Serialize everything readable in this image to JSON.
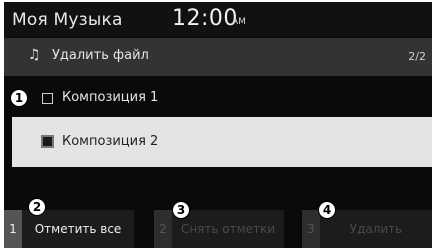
{
  "header": {
    "app_title": "Моя Музыка",
    "time": "12:00",
    "ampm": "AM"
  },
  "subheader": {
    "icon": "music-note-icon",
    "title": "Удалить файл",
    "page_indicator": "2/2"
  },
  "list": {
    "items": [
      {
        "label": "Композиция 1",
        "checked": false,
        "selected": false
      },
      {
        "label": "Композиция 2",
        "checked": true,
        "selected": true
      }
    ]
  },
  "softkeys": [
    {
      "number": "1",
      "label": "Отметить все",
      "enabled": true
    },
    {
      "number": "2",
      "label": "Снять отметки",
      "enabled": false
    },
    {
      "number": "3",
      "label": "Удалить",
      "enabled": false
    }
  ],
  "callouts": [
    "1",
    "2",
    "3",
    "4"
  ],
  "colors": {
    "screen_bg": "#0a0a0a",
    "subheader_bg": "#333333",
    "selected_row_bg": "#e4e4e4",
    "softkey_bg": "#1c1c1c",
    "softkey_number_bg": "#555555"
  }
}
